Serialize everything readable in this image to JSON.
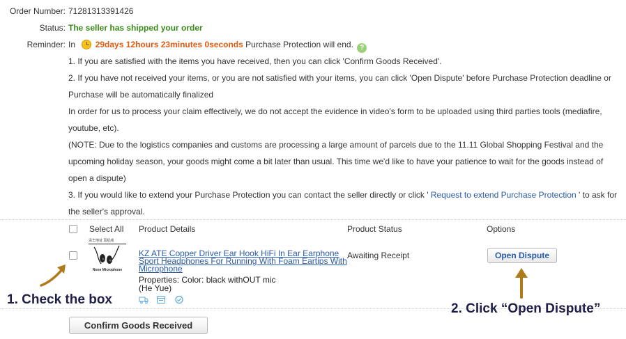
{
  "order": {
    "number_label": "Order Number:",
    "number_value": "71281313391426",
    "status_label": "Status:",
    "status_value": "The seller has shipped your order",
    "reminder_label": "Reminder:",
    "reminder_prefix": "In",
    "reminder_timer": "29days 12hours 23minutes 0seconds",
    "reminder_suffix": "Purchase Protection will end.",
    "help_icon_glyph": "?"
  },
  "notes": {
    "line1": "1. If you are satisfied with the items you have received, then you can click 'Confirm Goods Received'.",
    "line2": "2. If you have not received your items, or you are not satisfied with your items, you can click 'Open Dispute' before Purchase Protection deadline or Purchase will be automatically finalized",
    "line3": "In order for us to process your claim effectively, we do not accept the evidence in video's form to be uploaded using third parties tools (mediafire, youtube, etc).",
    "line4": "(NOTE: Due to the logistics companies and customs are processing a large amount of parcels due to the 11.11 Global Shopping Festival and the upcoming holiday season, your goods might come a bit later than usual. This time we'd like to have your patience to wait for the goods instead of open a dispute)",
    "line5_before": "3. If you would like to extend your Purchase Protection you can contact the seller directly or click '",
    "line5_link": " Request to extend Purchase Protection ",
    "line5_after": "' to ask for the seller's approval."
  },
  "table": {
    "col_select_all": "Select All",
    "col_product": "Product Details",
    "col_status": "Product Status",
    "col_options": "Options"
  },
  "item": {
    "thumb_top": "清华地址 耳机线",
    "thumb_caption": "None Microphone",
    "title": "KZ ATE Copper Driver Ear Hook HiFi In Ear Earphone Sport Headphones For Running With Foam Eartips With Microphone",
    "properties": "Properties: Color: black withOUT mic",
    "seller": "(He Yue)",
    "status": "Awaiting Receipt",
    "dispute_button": "Open Dispute"
  },
  "actions": {
    "confirm_button": "Confirm Goods Received"
  },
  "annotations": {
    "step1": "1. Check the box",
    "step2": "2. Click “Open Dispute”",
    "arrow_color": "#b07a1a"
  },
  "colors": {
    "link": "#2a5aa8",
    "status_green": "#3a8a1a",
    "timer_orange": "#e05a10"
  }
}
